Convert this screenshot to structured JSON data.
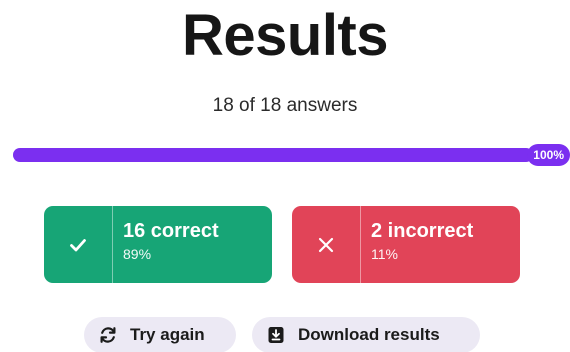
{
  "header": {
    "title": "Results",
    "subtitle": "18 of 18 answers"
  },
  "progress": {
    "value_percent": 100,
    "label": "100%",
    "fill_color": "#7b2ff0"
  },
  "summary": {
    "correct": {
      "icon": "check-icon",
      "count_label": "16 correct",
      "percent_label": "89%",
      "color": "#17a576"
    },
    "incorrect": {
      "icon": "close-icon",
      "count_label": "2 incorrect",
      "percent_label": "11%",
      "color": "#e14458"
    }
  },
  "actions": {
    "try_again": {
      "icon": "refresh-icon",
      "label": "Try again"
    },
    "download": {
      "icon": "download-icon",
      "label": "Download results"
    }
  }
}
